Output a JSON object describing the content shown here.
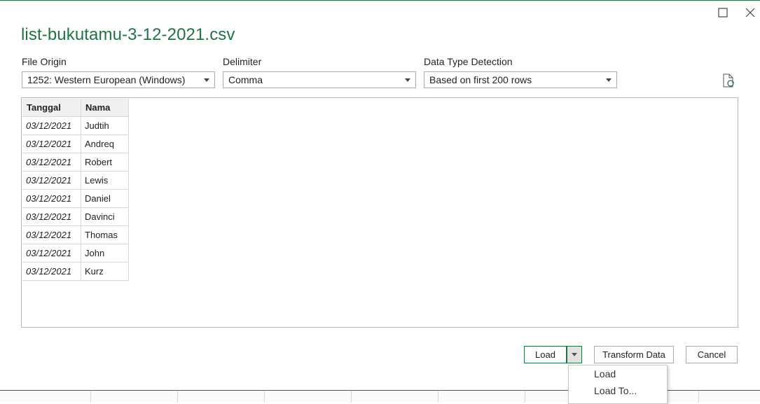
{
  "window": {
    "maximize_icon": "maximize-icon",
    "close_icon": "close-icon",
    "accent_color": "#217346"
  },
  "title": "list-bukutamu-3-12-2021.csv",
  "file_origin": {
    "label": "File Origin",
    "value": "1252: Western European (Windows)"
  },
  "delimiter": {
    "label": "Delimiter",
    "value": "Comma"
  },
  "data_type_detection": {
    "label": "Data Type Detection",
    "value": "Based on first 200 rows"
  },
  "refresh_icon": "refresh-file-icon",
  "table": {
    "headers": [
      "Tanggal",
      "Nama"
    ],
    "rows": [
      [
        "03/12/2021",
        "Judtih"
      ],
      [
        "03/12/2021",
        "Andreq"
      ],
      [
        "03/12/2021",
        "Robert"
      ],
      [
        "03/12/2021",
        "Lewis"
      ],
      [
        "03/12/2021",
        "Daniel"
      ],
      [
        "03/12/2021",
        "Davinci"
      ],
      [
        "03/12/2021",
        "Thomas"
      ],
      [
        "03/12/2021",
        "John"
      ],
      [
        "03/12/2021",
        "Kurz"
      ]
    ]
  },
  "buttons": {
    "load": "Load",
    "transform": "Transform Data",
    "cancel": "Cancel"
  },
  "load_menu": {
    "items": [
      "Load",
      "Load To..."
    ]
  }
}
